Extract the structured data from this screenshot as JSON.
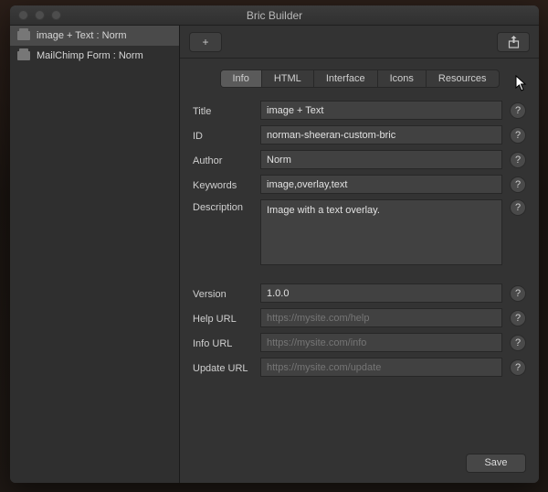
{
  "window": {
    "title": "Bric Builder"
  },
  "sidebar": {
    "items": [
      {
        "label": "image + Text : Norm",
        "selected": true
      },
      {
        "label": "MailChimp Form : Norm",
        "selected": false
      }
    ]
  },
  "toolbar": {
    "add_label": "+",
    "share_label": "Share"
  },
  "tabs": {
    "items": [
      {
        "label": "Info",
        "active": true
      },
      {
        "label": "HTML",
        "active": false
      },
      {
        "label": "Interface",
        "active": false
      },
      {
        "label": "Icons",
        "active": false
      },
      {
        "label": "Resources",
        "active": false
      }
    ]
  },
  "form": {
    "rows": [
      {
        "label": "Title",
        "value": "image + Text",
        "placeholder": ""
      },
      {
        "label": "ID",
        "value": "norman-sheeran-custom-bric",
        "placeholder": ""
      },
      {
        "label": "Author",
        "value": "Norm",
        "placeholder": ""
      },
      {
        "label": "Keywords",
        "value": "image,overlay,text",
        "placeholder": ""
      },
      {
        "label": "Description",
        "value": "Image with a text overlay.",
        "placeholder": "",
        "type": "textarea"
      },
      {
        "gap": true
      },
      {
        "label": "Version",
        "value": "1.0.0",
        "placeholder": ""
      },
      {
        "label": "Help URL",
        "value": "",
        "placeholder": "https://mysite.com/help"
      },
      {
        "label": "Info URL",
        "value": "",
        "placeholder": "https://mysite.com/info"
      },
      {
        "label": "Update URL",
        "value": "",
        "placeholder": "https://mysite.com/update"
      }
    ],
    "help_tooltip": "?"
  },
  "footer": {
    "save_label": "Save"
  }
}
